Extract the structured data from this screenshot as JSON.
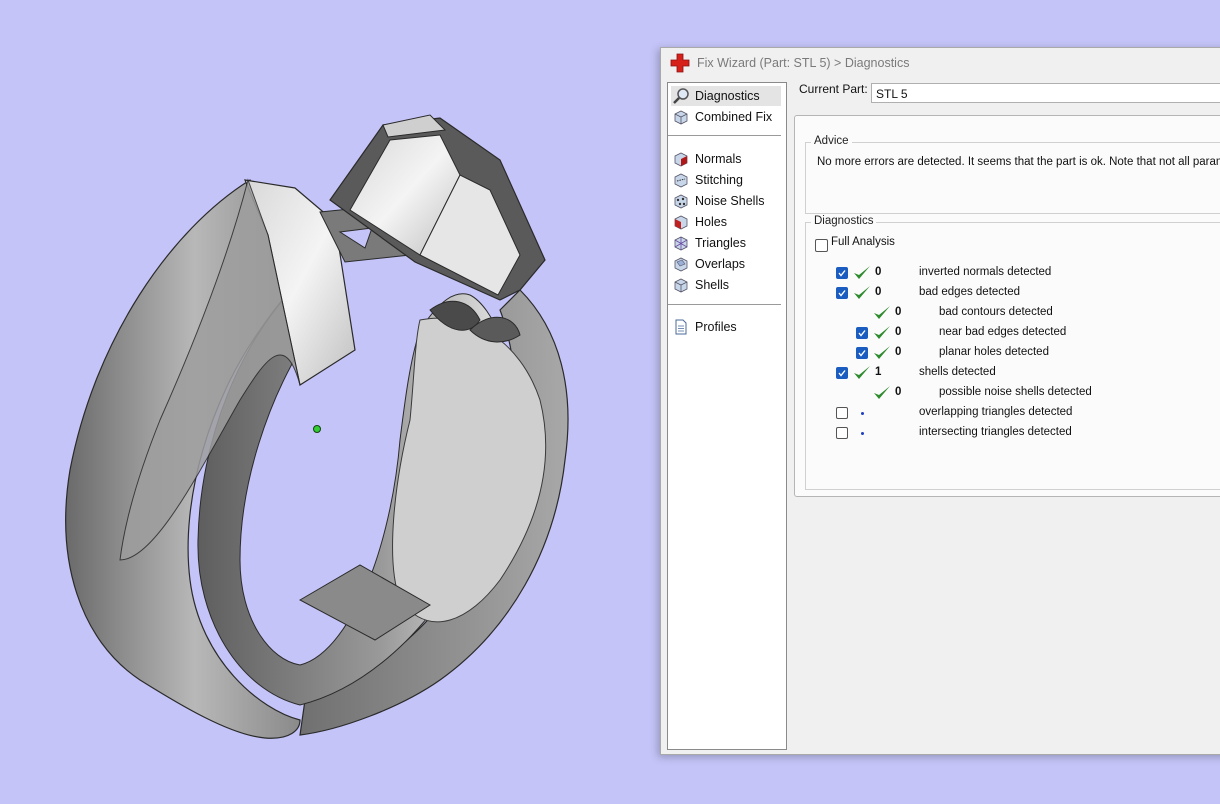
{
  "window": {
    "title": "Fix Wizard (Part: STL 5) > Diagnostics"
  },
  "sidebar": {
    "items": [
      {
        "label": "Diagnostics",
        "icon": "magnifier-icon"
      },
      {
        "label": "Combined Fix",
        "icon": "cube-icon"
      },
      {
        "label": "Normals",
        "icon": "normals-cube-icon"
      },
      {
        "label": "Stitching",
        "icon": "stitching-cube-icon"
      },
      {
        "label": "Noise Shells",
        "icon": "noise-shells-icon"
      },
      {
        "label": "Holes",
        "icon": "holes-cube-icon"
      },
      {
        "label": "Triangles",
        "icon": "triangles-cube-icon"
      },
      {
        "label": "Overlaps",
        "icon": "overlaps-cube-icon"
      },
      {
        "label": "Shells",
        "icon": "shells-cube-icon"
      },
      {
        "label": "Profiles",
        "icon": "document-icon"
      }
    ]
  },
  "current_part": {
    "label": "Current Part:",
    "value": "STL 5"
  },
  "advice": {
    "title": "Advice",
    "text": "No more errors are detected. It seems that the part is ok. Note that not all paramete"
  },
  "diagnostics": {
    "title": "Diagnostics",
    "full_analysis_label": "Full Analysis",
    "rows": [
      {
        "count": "0",
        "label": "inverted normals detected"
      },
      {
        "count": "0",
        "label": "bad edges detected"
      },
      {
        "count": "0",
        "label": "bad contours detected"
      },
      {
        "count": "0",
        "label": "near bad edges detected"
      },
      {
        "count": "0",
        "label": "planar holes detected"
      },
      {
        "count": "1",
        "label": "shells detected"
      },
      {
        "count": "0",
        "label": "possible noise shells detected"
      },
      {
        "count": "",
        "label": "overlapping triangles detected"
      },
      {
        "count": "",
        "label": "intersecting triangles detected"
      }
    ]
  },
  "colors": {
    "viewport_bg": "#c4c4f8",
    "check_green": "#2e8b2e",
    "checkbox_blue": "#1a5cc0",
    "app_icon_red": "#d8201a"
  }
}
